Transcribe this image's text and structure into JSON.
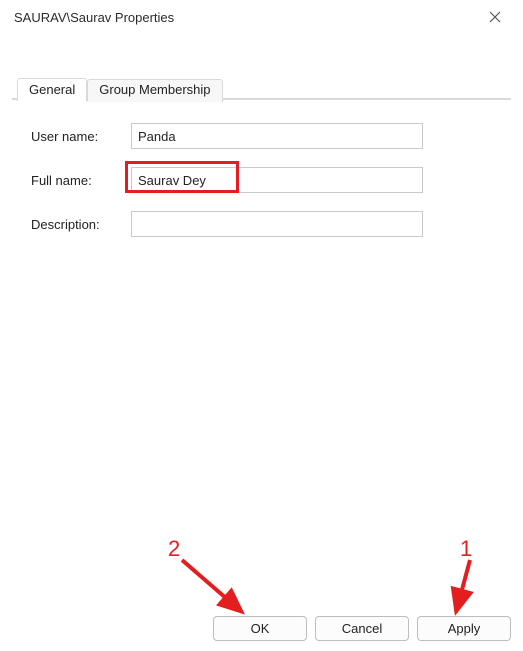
{
  "window": {
    "title": "SAURAV\\Saurav Properties"
  },
  "tabs": {
    "general": "General",
    "group_membership": "Group Membership"
  },
  "form": {
    "username_label": "User name:",
    "username_value": "Panda",
    "fullname_label": "Full name:",
    "fullname_value": "Saurav Dey",
    "description_label": "Description:",
    "description_value": ""
  },
  "buttons": {
    "ok": "OK",
    "cancel": "Cancel",
    "apply": "Apply"
  },
  "annotations": {
    "num1": "1",
    "num2": "2"
  }
}
